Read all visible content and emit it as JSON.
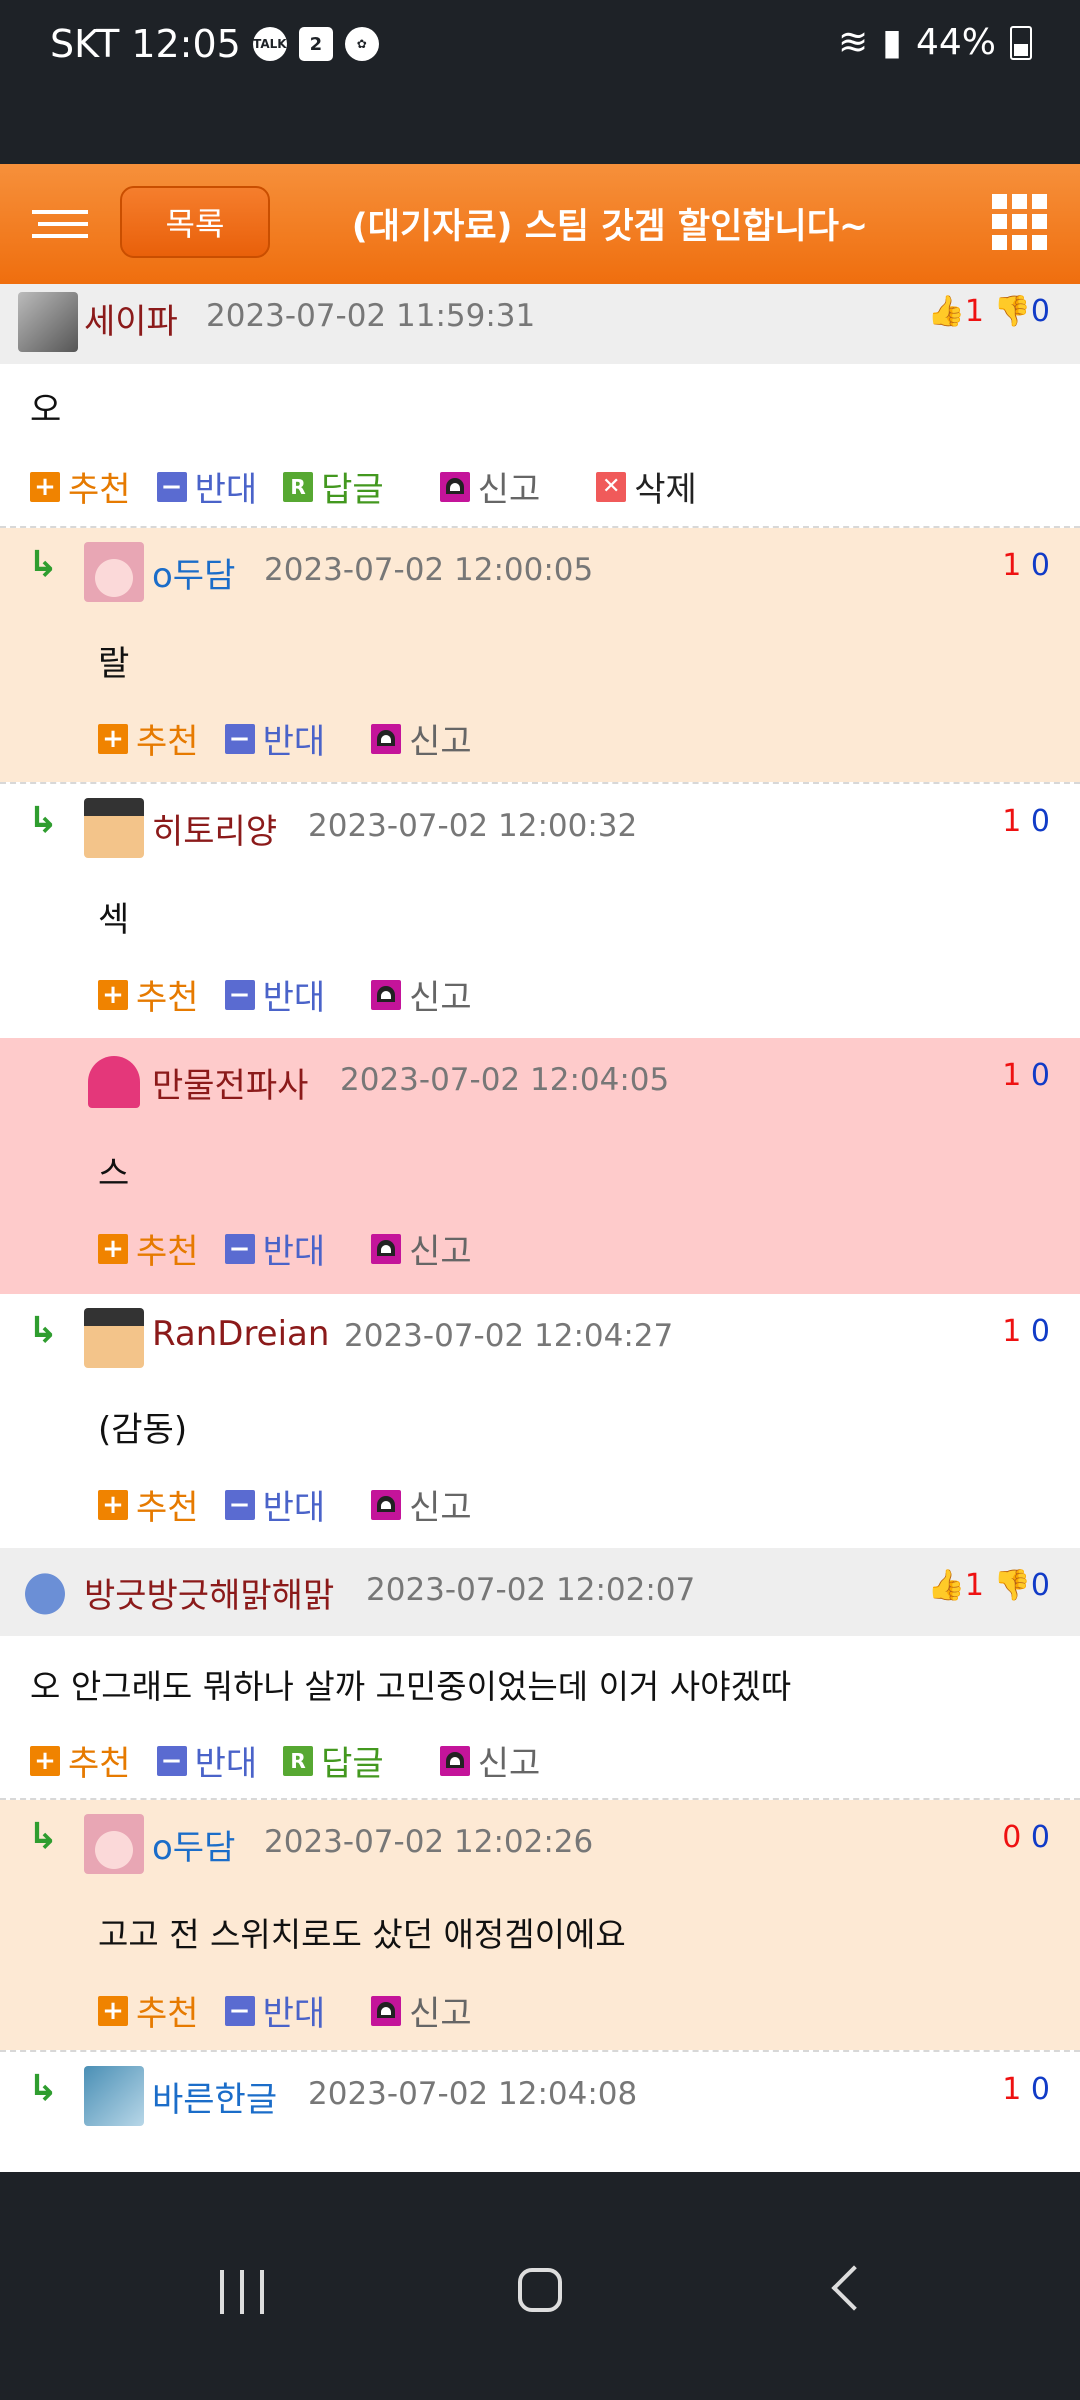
{
  "status_bar": {
    "carrier": "SKT",
    "time": "12:05",
    "notif_talk": "TALK",
    "notif_cal": "2",
    "battery": "44%"
  },
  "header": {
    "list_button": "목록",
    "title": "(대기자료) 스팀 갓겜 할인합니다~"
  },
  "actions": {
    "up": "추천",
    "down": "반대",
    "reply": "답글",
    "report": "신고",
    "delete": "삭제",
    "reply_badge": "R"
  },
  "comments": [
    {
      "user": "세이파",
      "date": "2023-07-02 11:59:31",
      "text": "오",
      "up": "1",
      "down": "0"
    },
    {
      "user": "o두담",
      "date": "2023-07-02 12:00:05",
      "text": "랄",
      "up": "1",
      "down": "0"
    },
    {
      "user": "히토리양",
      "date": "2023-07-02 12:00:32",
      "text": "섹",
      "up": "1",
      "down": "0"
    },
    {
      "user": "만물전파사",
      "date": "2023-07-02 12:04:05",
      "text": "스",
      "up": "1",
      "down": "0"
    },
    {
      "user": "RanDreian",
      "date": "2023-07-02 12:04:27",
      "text": "(감동)",
      "up": "1",
      "down": "0"
    },
    {
      "user": "방긋방긋해맑해맑",
      "date": "2023-07-02 12:02:07",
      "text": "오 안그래도 뭐하나 살까 고민중이었는데 이거 사야겠따",
      "up": "1",
      "down": "0"
    },
    {
      "user": "o두담",
      "date": "2023-07-02 12:02:26",
      "text": "고고 전 스위치로도 샀던 애정겜이에요",
      "up": "0",
      "down": "0"
    },
    {
      "user": "바른한글",
      "date": "2023-07-02 12:04:08",
      "text": "",
      "up": "1",
      "down": "0"
    }
  ]
}
